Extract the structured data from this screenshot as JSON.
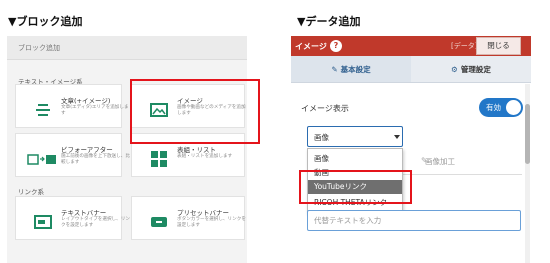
{
  "headings": {
    "left": "▼ブロック追加",
    "right": "▼データ追加"
  },
  "block_panel": {
    "top_bar": "ブロック追加",
    "sections": [
      {
        "label": "テキスト・イメージ系",
        "cards": [
          {
            "title": "文章(+イメージ)",
            "desc": "文章(エディタ)エリアを追加します",
            "icon": "text-lines-icon"
          },
          {
            "title": "イメージ",
            "desc": "画像や動画などのメディアを追加します",
            "icon": "image-icon"
          },
          {
            "title": "ビフォーアフター",
            "desc": "施工前後の画像を上下放送し、比較します",
            "icon": "before-after-icon"
          },
          {
            "title": "表組・リスト",
            "desc": "表組・リストを追加します",
            "icon": "table-icon"
          }
        ]
      },
      {
        "label": "リンク系",
        "cards": [
          {
            "title": "テキストバナー",
            "desc": "レイアウトタイプを選択し、リンクを設定します",
            "icon": "text-banner-icon"
          },
          {
            "title": "プリセットバナー",
            "desc": "ボタンカラーを選択し、リンクを設定します",
            "icon": "preset-banner-icon"
          }
        ]
      }
    ]
  },
  "data_panel": {
    "header_title": "イメージ",
    "header_tag": "[データ]",
    "close_label": "閉じる",
    "tabs": [
      {
        "label": "基本設定",
        "icon": "edit-icon"
      },
      {
        "label": "管理設定",
        "icon": "gear-icon"
      }
    ],
    "image_display_label": "イメージ表示",
    "toggle_label": "有効",
    "select_value": "画像",
    "background_tabs": [
      "画像加工",
      "画像加工"
    ],
    "dropdown_options": [
      "画像",
      "動画",
      "YouTubeリンク",
      "RICOH THETAリンク"
    ],
    "selected_option": "YouTubeリンク",
    "alt_placeholder": "代替テキストを入力"
  }
}
